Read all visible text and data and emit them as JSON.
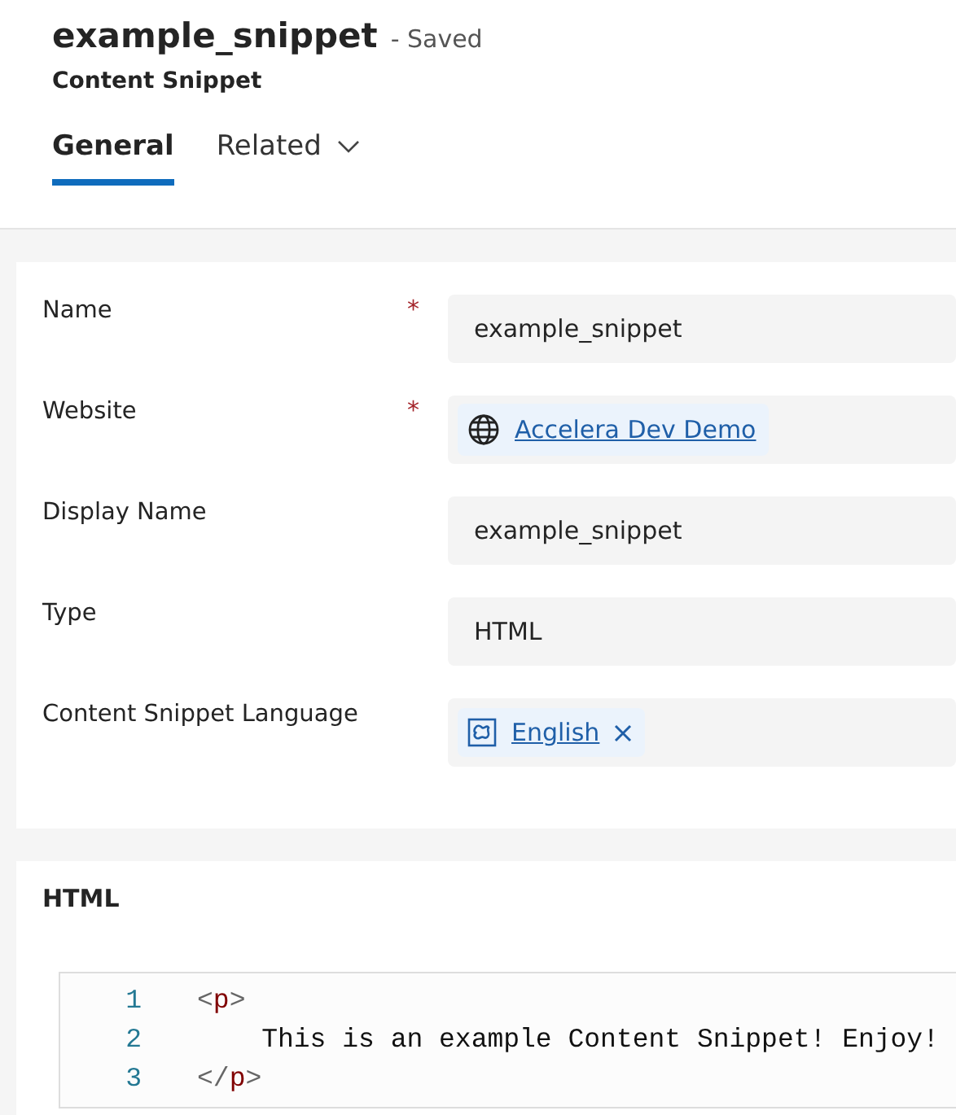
{
  "header": {
    "title": "example_snippet",
    "status": "- Saved",
    "entity": "Content Snippet"
  },
  "tabs": [
    {
      "label": "General",
      "selected": true,
      "dropdown": false
    },
    {
      "label": "Related",
      "selected": false,
      "dropdown": true
    }
  ],
  "fields": [
    {
      "label": "Name",
      "required_mark": "*",
      "kind": "text",
      "value": "example_snippet"
    },
    {
      "label": "Website",
      "required_mark": "*",
      "kind": "lookup",
      "value": "Accelera Dev Demo"
    },
    {
      "label": "Display Name",
      "kind": "text",
      "value": "example_snippet"
    },
    {
      "label": "Type",
      "kind": "text",
      "value": "HTML"
    },
    {
      "label": "Content Snippet Language",
      "kind": "tag",
      "value": "English"
    }
  ],
  "html_section": {
    "title": "HTML",
    "lines": [
      {
        "number": "1",
        "tokens": [
          {
            "kind": "bracket",
            "text": "<"
          },
          {
            "kind": "tag",
            "text": "p"
          },
          {
            "kind": "bracket",
            "text": ">"
          }
        ]
      },
      {
        "number": "2",
        "tokens": [
          {
            "kind": "text",
            "text": "    This is an example Content Snippet! Enjoy!"
          }
        ]
      },
      {
        "number": "3",
        "tokens": [
          {
            "kind": "bracket",
            "text": "</"
          },
          {
            "kind": "tag",
            "text": "p"
          },
          {
            "kind": "bracket",
            "text": ">"
          }
        ]
      }
    ]
  }
}
